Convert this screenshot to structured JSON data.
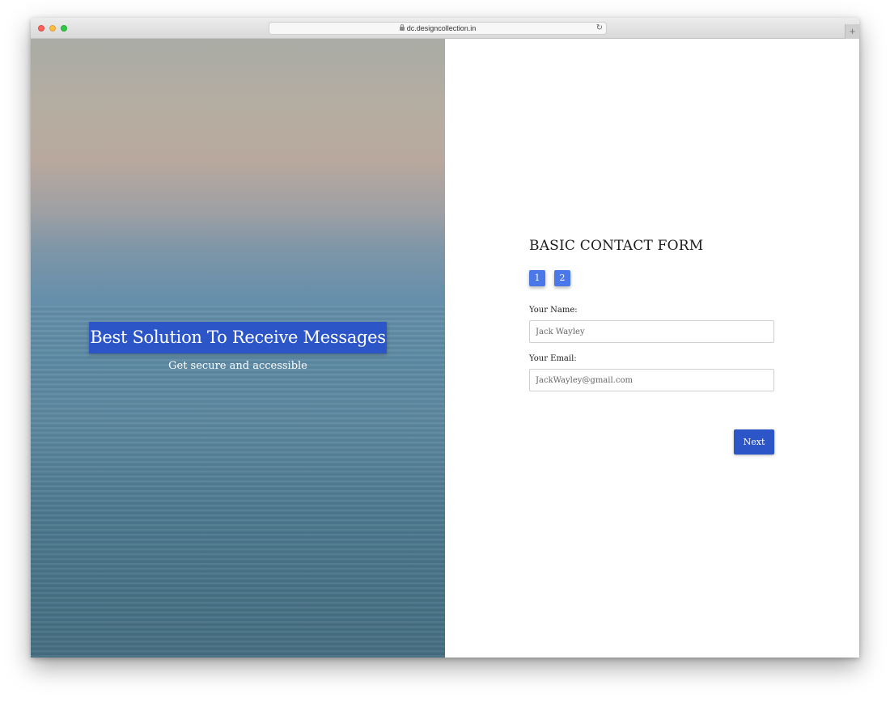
{
  "browser": {
    "url": "dc.designcollection.in",
    "reload_icon": "reload-icon",
    "new_tab_label": "+"
  },
  "hero": {
    "title": "Best Solution To Receive Messages",
    "subtitle": "Get secure and accessible"
  },
  "form": {
    "title": "BASIC CONTACT FORM",
    "steps": [
      "1",
      "2"
    ],
    "name_label": "Your Name:",
    "name_placeholder": "Jack Wayley",
    "email_label": "Your Email:",
    "email_placeholder": "JackWayley@gmail.com",
    "next_label": "Next"
  },
  "colors": {
    "accent": "#2c56c8",
    "step_badge": "#4a78e8"
  }
}
